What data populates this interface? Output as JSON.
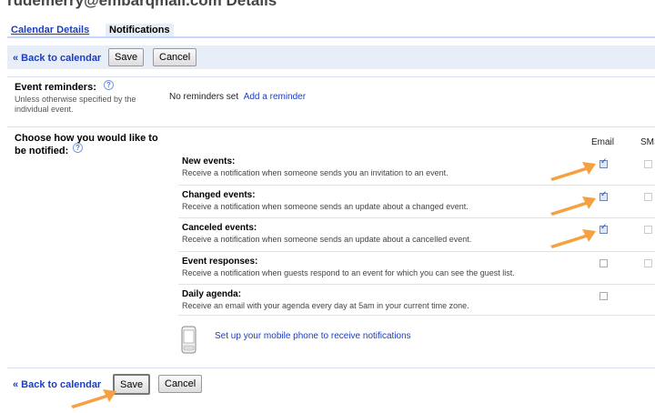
{
  "page": {
    "title": "rudemerry@embarqmail.com Details"
  },
  "tabs": [
    {
      "label": "Calendar Details"
    },
    {
      "label": "Notifications"
    }
  ],
  "actions": {
    "back_label": "« Back to calendar",
    "save_label": "Save",
    "cancel_label": "Cancel"
  },
  "reminders": {
    "label": "Event reminders:",
    "note": "Unless otherwise specified by the individual event.",
    "status": "No reminders set",
    "add_link": "Add a reminder"
  },
  "notify": {
    "label": "Choose how you would like to be notified:",
    "columns": [
      "Email",
      "SMS"
    ],
    "events": [
      {
        "title": "New events:",
        "desc": "Receive a notification when someone sends you an invitation to an event.",
        "email_checked": true,
        "sms_checked": false
      },
      {
        "title": "Changed events:",
        "desc": "Receive a notification when someone sends an update about a changed event.",
        "email_checked": true,
        "sms_checked": false
      },
      {
        "title": "Canceled events:",
        "desc": "Receive a notification when someone sends an update about a cancelled event.",
        "email_checked": true,
        "sms_checked": false
      },
      {
        "title": "Event responses:",
        "desc": "Receive a notification when guests respond to an event for which you can see the guest list.",
        "email_checked": false,
        "sms_checked": false
      },
      {
        "title": "Daily agenda:",
        "desc": "Receive an email with your agenda every day at 5am in your current time zone.",
        "email_checked": false
      }
    ],
    "mobile_link": "Set up your mobile phone to receive notifications"
  },
  "colors": {
    "link": "#1a3dc1",
    "actionbar": "#e8eef7",
    "arrow": "#f5a142"
  }
}
